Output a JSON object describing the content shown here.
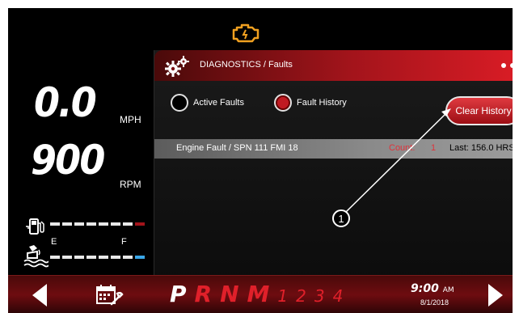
{
  "dashboard": {
    "speed": "0.0",
    "speed_unit": "MPH",
    "rpm": "900",
    "rpm_unit": "RPM",
    "def_empty_label": "E",
    "def_full_label": "F",
    "status_icon": "check-engine-icon"
  },
  "panel": {
    "title": "DIAGNOSTICS / Faults",
    "radio_active_label": "Active Faults",
    "radio_history_label": "Fault History",
    "selected_view": "Fault History",
    "clear_button_label": "Clear History",
    "faults": [
      {
        "name": "Engine Fault / SPN 111 FMI 18",
        "count_label": "Count:",
        "count": "1",
        "last": "Last: 156.0 HRS"
      }
    ]
  },
  "callout": {
    "number": "1"
  },
  "bottom_bar": {
    "gears": [
      "P",
      "R",
      "N",
      "M",
      "1",
      "2",
      "3",
      "4"
    ],
    "active_gear": "P",
    "time": "9:00",
    "ampm": "AM",
    "date": "8/1/2018"
  },
  "colors": {
    "accent_red": "#c8161d",
    "gear_red": "#e0202a",
    "fuel_bar_end": "#a3141b",
    "def_bar_end": "#3aa6e8"
  }
}
